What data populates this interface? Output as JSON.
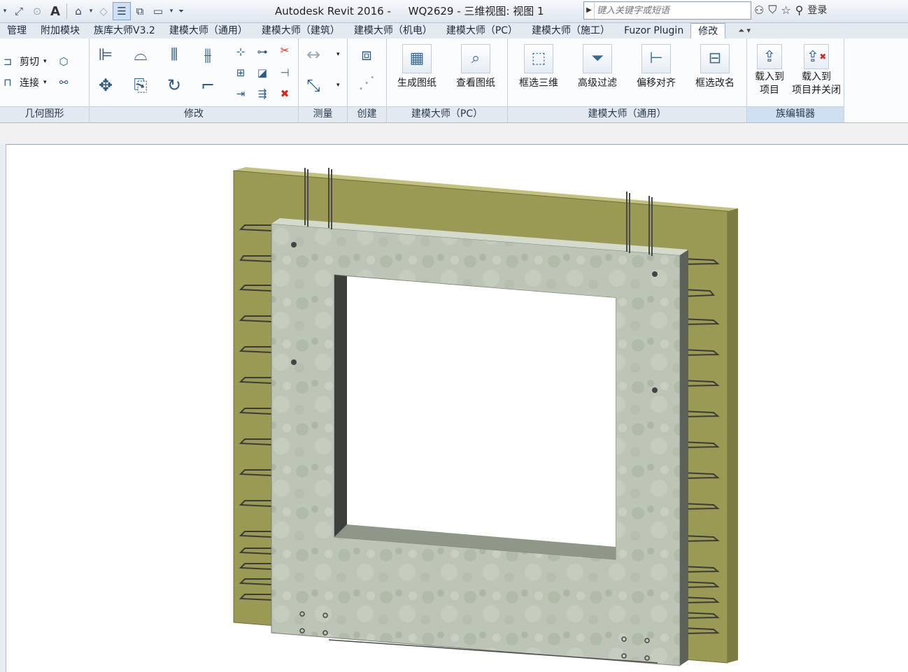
{
  "app": {
    "title": "Autodesk Revit 2016 -",
    "document": "WQ2629 - 三维视图: 视图 1"
  },
  "search": {
    "placeholder": "键入关键字或短语"
  },
  "titlebar": {
    "login": "登录"
  },
  "tabs": [
    {
      "label": "管理"
    },
    {
      "label": "附加模块"
    },
    {
      "label": "族库大师V3.2"
    },
    {
      "label": "建模大师（通用）"
    },
    {
      "label": "建模大师（建筑）"
    },
    {
      "label": "建模大师（机电）"
    },
    {
      "label": "建模大师（PC）"
    },
    {
      "label": "建模大师（施工）"
    },
    {
      "label": "Fuzor Plugin"
    },
    {
      "label": "修改"
    }
  ],
  "ribbon": {
    "geometry": {
      "label": "几何图形",
      "cut": "剪切",
      "join": "连接"
    },
    "modify": {
      "label": "修改"
    },
    "measure": {
      "label": "测量"
    },
    "create": {
      "label": "创建"
    },
    "pc": {
      "label": "建模大师（PC）",
      "generate_drawing": "生成图纸",
      "view_drawing": "查看图纸"
    },
    "general": {
      "label": "建模大师（通用）",
      "box_3d": "框选三维",
      "adv_filter": "高级过滤",
      "offset_align": "偏移对齐",
      "box_rename": "框选改名"
    },
    "family_editor": {
      "label": "族编辑器",
      "load_l1": "载入到",
      "load_l2": "项目",
      "loadclose_l1": "载入到",
      "loadclose_l2": "项目并关闭"
    }
  },
  "colors": {
    "insulation": "#9a9a54",
    "concrete": "#b9c3b1",
    "rebar": "#3b3b3b",
    "accent": "#cde0f5"
  }
}
